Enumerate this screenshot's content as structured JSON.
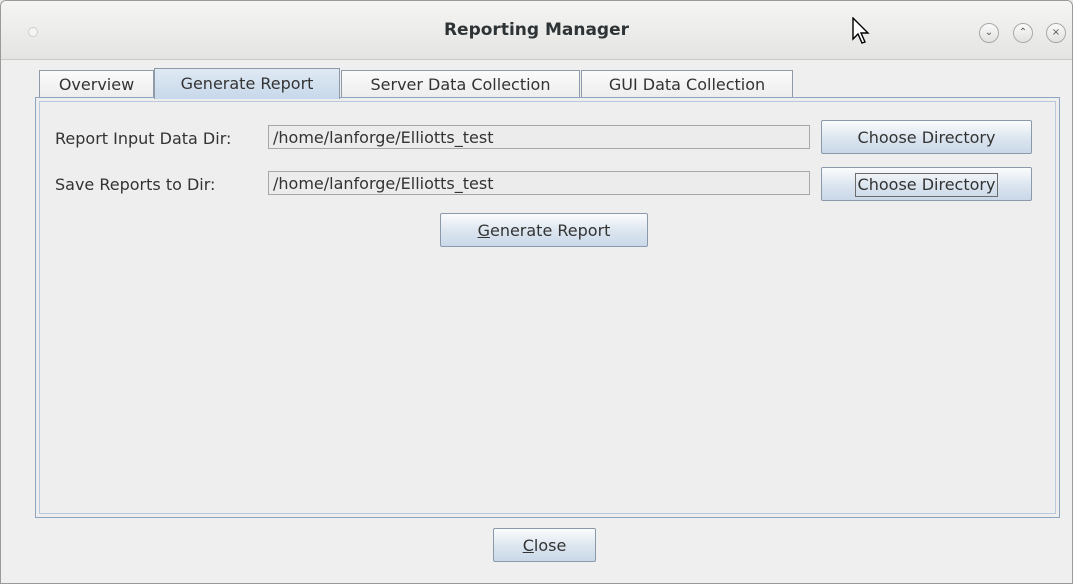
{
  "window": {
    "title": "Reporting Manager",
    "controls": {
      "minimize_glyph": "⌄",
      "maximize_glyph": "⌃",
      "close_glyph": "×"
    }
  },
  "tabs": [
    {
      "label": "Overview",
      "active": false
    },
    {
      "label": "Generate Report",
      "active": true
    },
    {
      "label": "Server Data Collection",
      "active": false
    },
    {
      "label": "GUI Data Collection",
      "active": false
    }
  ],
  "form": {
    "input_dir_label": "Report Input Data Dir:",
    "input_dir_value": "/home/lanforge/Elliotts_test",
    "choose_dir_1": "Choose Directory",
    "save_dir_label": "Save Reports to Dir:",
    "save_dir_value": "/home/lanforge/Elliotts_test",
    "choose_dir_2": "Choose Directory",
    "generate_mnemonic": "G",
    "generate_rest": "enerate Report"
  },
  "footer": {
    "close_mnemonic": "C",
    "close_rest": "lose"
  },
  "icons": {
    "cursor": "mouse-pointer-icon"
  }
}
